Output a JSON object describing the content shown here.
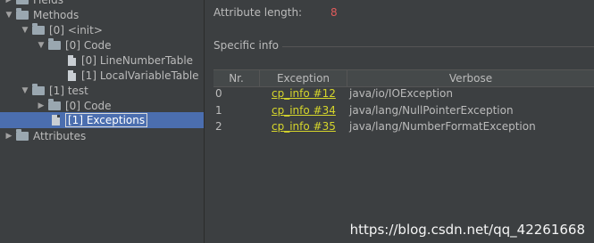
{
  "tree": {
    "fields_label": "Fields",
    "methods_label": "Methods",
    "init_label": "[0] <init>",
    "init_code_label": "[0] Code",
    "line_number_table_label": "[0] LineNumberTable",
    "local_variable_table_label": "[1] LocalVariableTable",
    "test_label": "[1] test",
    "test_code_label": "[0] Code",
    "exceptions_label": "[1] Exceptions",
    "attributes_label": "Attributes",
    "arrow_expanded": "▼",
    "arrow_collapsed": "▶"
  },
  "detail": {
    "attribute_length_label": "Attribute length:",
    "attribute_length_value": "8",
    "specific_info_label": "Specific info"
  },
  "table": {
    "headers": [
      "Nr.",
      "Exception",
      "Verbose"
    ],
    "rows": [
      {
        "nr": "0",
        "exception": "cp_info #12",
        "verbose": "java/io/IOException"
      },
      {
        "nr": "1",
        "exception": "cp_info #34",
        "verbose": "java/lang/NullPointerException"
      },
      {
        "nr": "2",
        "exception": "cp_info #35",
        "verbose": "java/lang/NumberFormatException"
      }
    ]
  },
  "watermark": "https://blog.csdn.net/qq_42261668",
  "colors": {
    "background": "#3c3f41",
    "selection": "#4b6eaf",
    "link": "#d6d62b",
    "value_red": "#e05b5b"
  }
}
